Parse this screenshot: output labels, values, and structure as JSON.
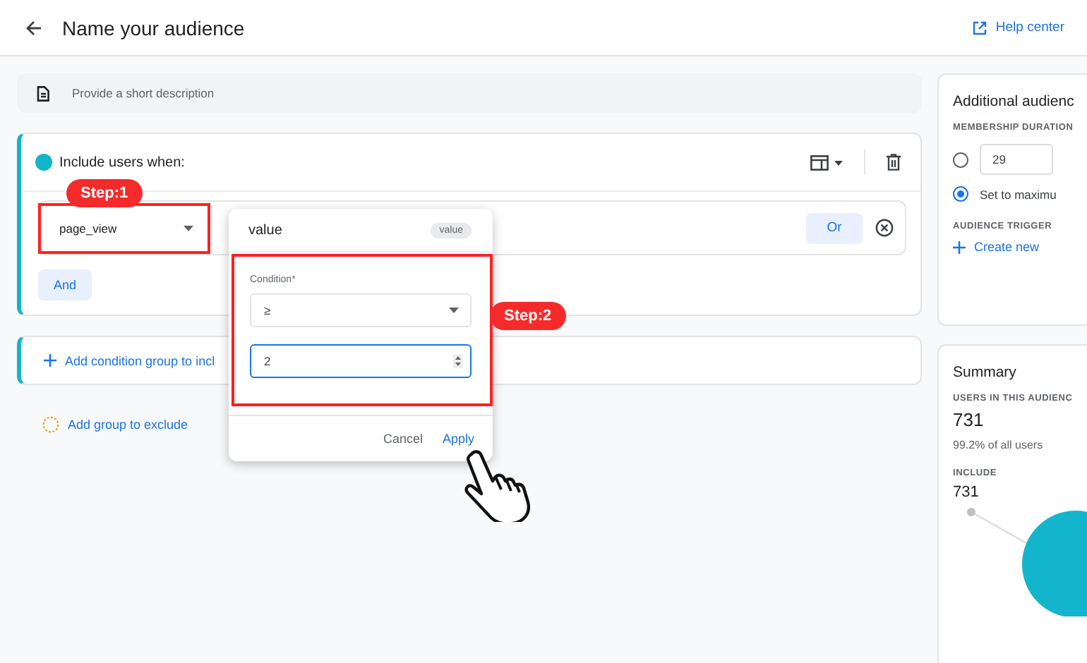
{
  "header": {
    "title": "Name your audience",
    "help_link": "Help center"
  },
  "description": {
    "placeholder": "Provide a short description"
  },
  "include_group": {
    "title": "Include users when:",
    "condition": {
      "event": "page_view",
      "or_button": "Or"
    },
    "and_button": "And"
  },
  "add_condition_group": "Add condition group to incl",
  "add_exclude_group": "Add group to exclude",
  "popup": {
    "title": "value",
    "chip": "value",
    "condition_label": "Condition*",
    "operator": "≥",
    "value": "2",
    "buttons": [
      {
        "label": "Cancel",
        "kind": "text"
      },
      {
        "label": "Apply",
        "kind": "primary"
      }
    ]
  },
  "annotations": [
    {
      "label": "Step:1"
    },
    {
      "label": "Step:2"
    }
  ],
  "additional_settings": {
    "title": "Additional audienc",
    "membership_label": "MEMBERSHIP DURATION",
    "options": [
      {
        "kind": "days",
        "value": "29",
        "selected": false
      },
      {
        "kind": "maximum",
        "label": "Set to maximu",
        "selected": true
      }
    ],
    "trigger_label": "AUDIENCE TRIGGER",
    "create_link": "Create new"
  },
  "summary": {
    "title": "Summary",
    "users_label": "USERS IN THIS AUDIENC",
    "users_count": "731",
    "users_share": "99.2% of all users",
    "include_label": "INCLUDE",
    "include_count": "731"
  }
}
